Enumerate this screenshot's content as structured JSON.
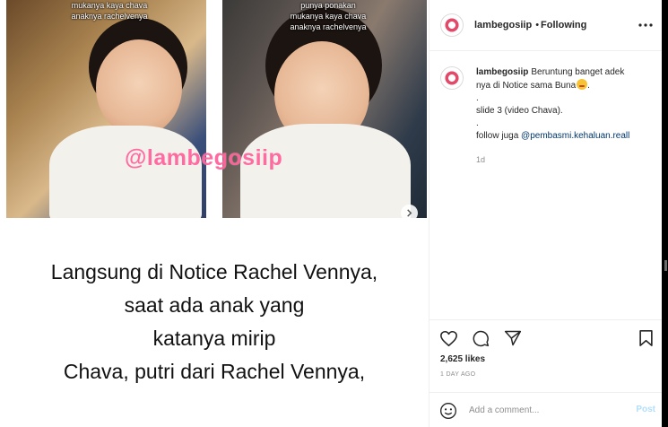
{
  "post": {
    "left_caption_lines": [
      "mukanya kaya chava",
      "anaknya rachelvenya"
    ],
    "right_caption_lines": [
      "punya ponakan",
      "mukanya kaya chava",
      "anaknya rachelvenya"
    ],
    "watermark": "@lambegosiip",
    "headline_lines": [
      "Langsung di Notice Rachel Vennya,",
      "saat ada anak yang",
      "katanya mirip",
      "Chava, putri dari Rachel Vennya,"
    ]
  },
  "header": {
    "username": "lambegosiip",
    "separator": "•",
    "follow_status": "Following"
  },
  "caption": {
    "username": "lambegosiip",
    "text_line1": "Beruntung banget adek",
    "text_line2": "nya di Notice sama Buna",
    "dot1": ".",
    "slide_text": "slide 3 (video Chava).",
    "dot2": ".",
    "follow_prefix": "follow juga",
    "mention": "@pembasmi.kehaluan.reall",
    "time": "1d"
  },
  "actions": {
    "likes": "2,625 likes",
    "post_age": "1 DAY AGO"
  },
  "comment": {
    "placeholder": "Add a comment...",
    "post_label": "Post"
  },
  "icons": {
    "like": "heart-icon",
    "comment": "comment-icon",
    "share": "share-icon",
    "save": "bookmark-icon",
    "more": "more-icon",
    "next": "chevron-right-icon",
    "emoji": "emoji-icon"
  },
  "colors": {
    "watermark": "#ff5a96",
    "mention": "#00376b",
    "post_disabled": "#b2dffc",
    "muted": "#8e8e8e"
  }
}
